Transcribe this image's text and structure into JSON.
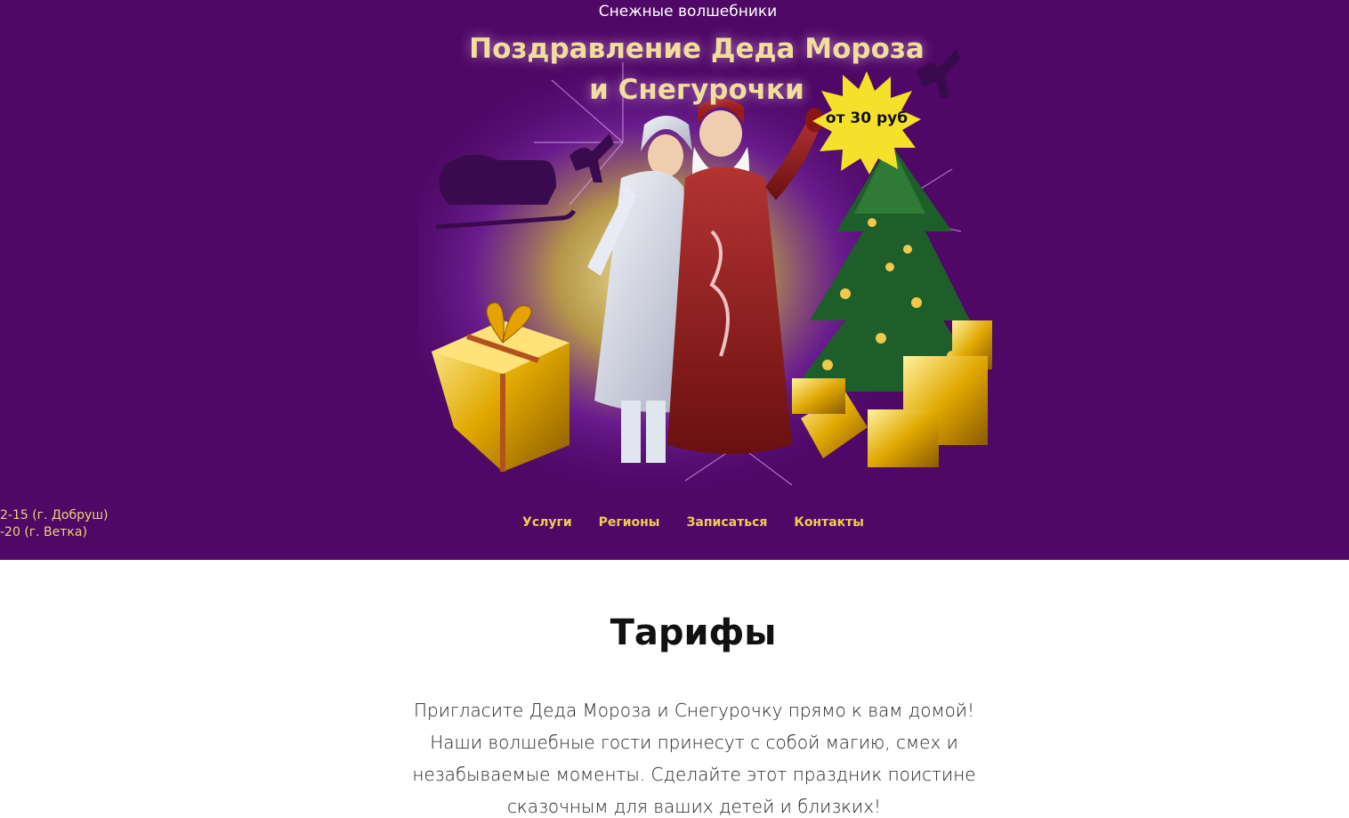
{
  "header": {
    "site_name": "Снежные волшебники",
    "title_line1": "Поздравление Деда Мороза",
    "title_line2": "и Снегурочки",
    "price_badge": "от 30 руб"
  },
  "contacts": {
    "phones": [
      "2-15 (г. Добруш)",
      "-20 (г. Ветка)"
    ]
  },
  "nav": {
    "items": [
      "Услуги",
      "Регионы",
      "Записаться",
      "Контакты"
    ]
  },
  "tariffs": {
    "heading": "Тарифы",
    "text": "Пригласите Деда Мороза и Снегурочку прямо к вам домой! Наши волшебные гости принесут с собой магию, смех и незабываемые моменты. Сделайте этот праздник поистине сказочным для ваших детей и близких!"
  },
  "colors": {
    "hero_background": "#4f0866",
    "title_text": "#f2dd9c",
    "nav_text": "#f0cc55",
    "price_badge": "#f5e02a"
  }
}
